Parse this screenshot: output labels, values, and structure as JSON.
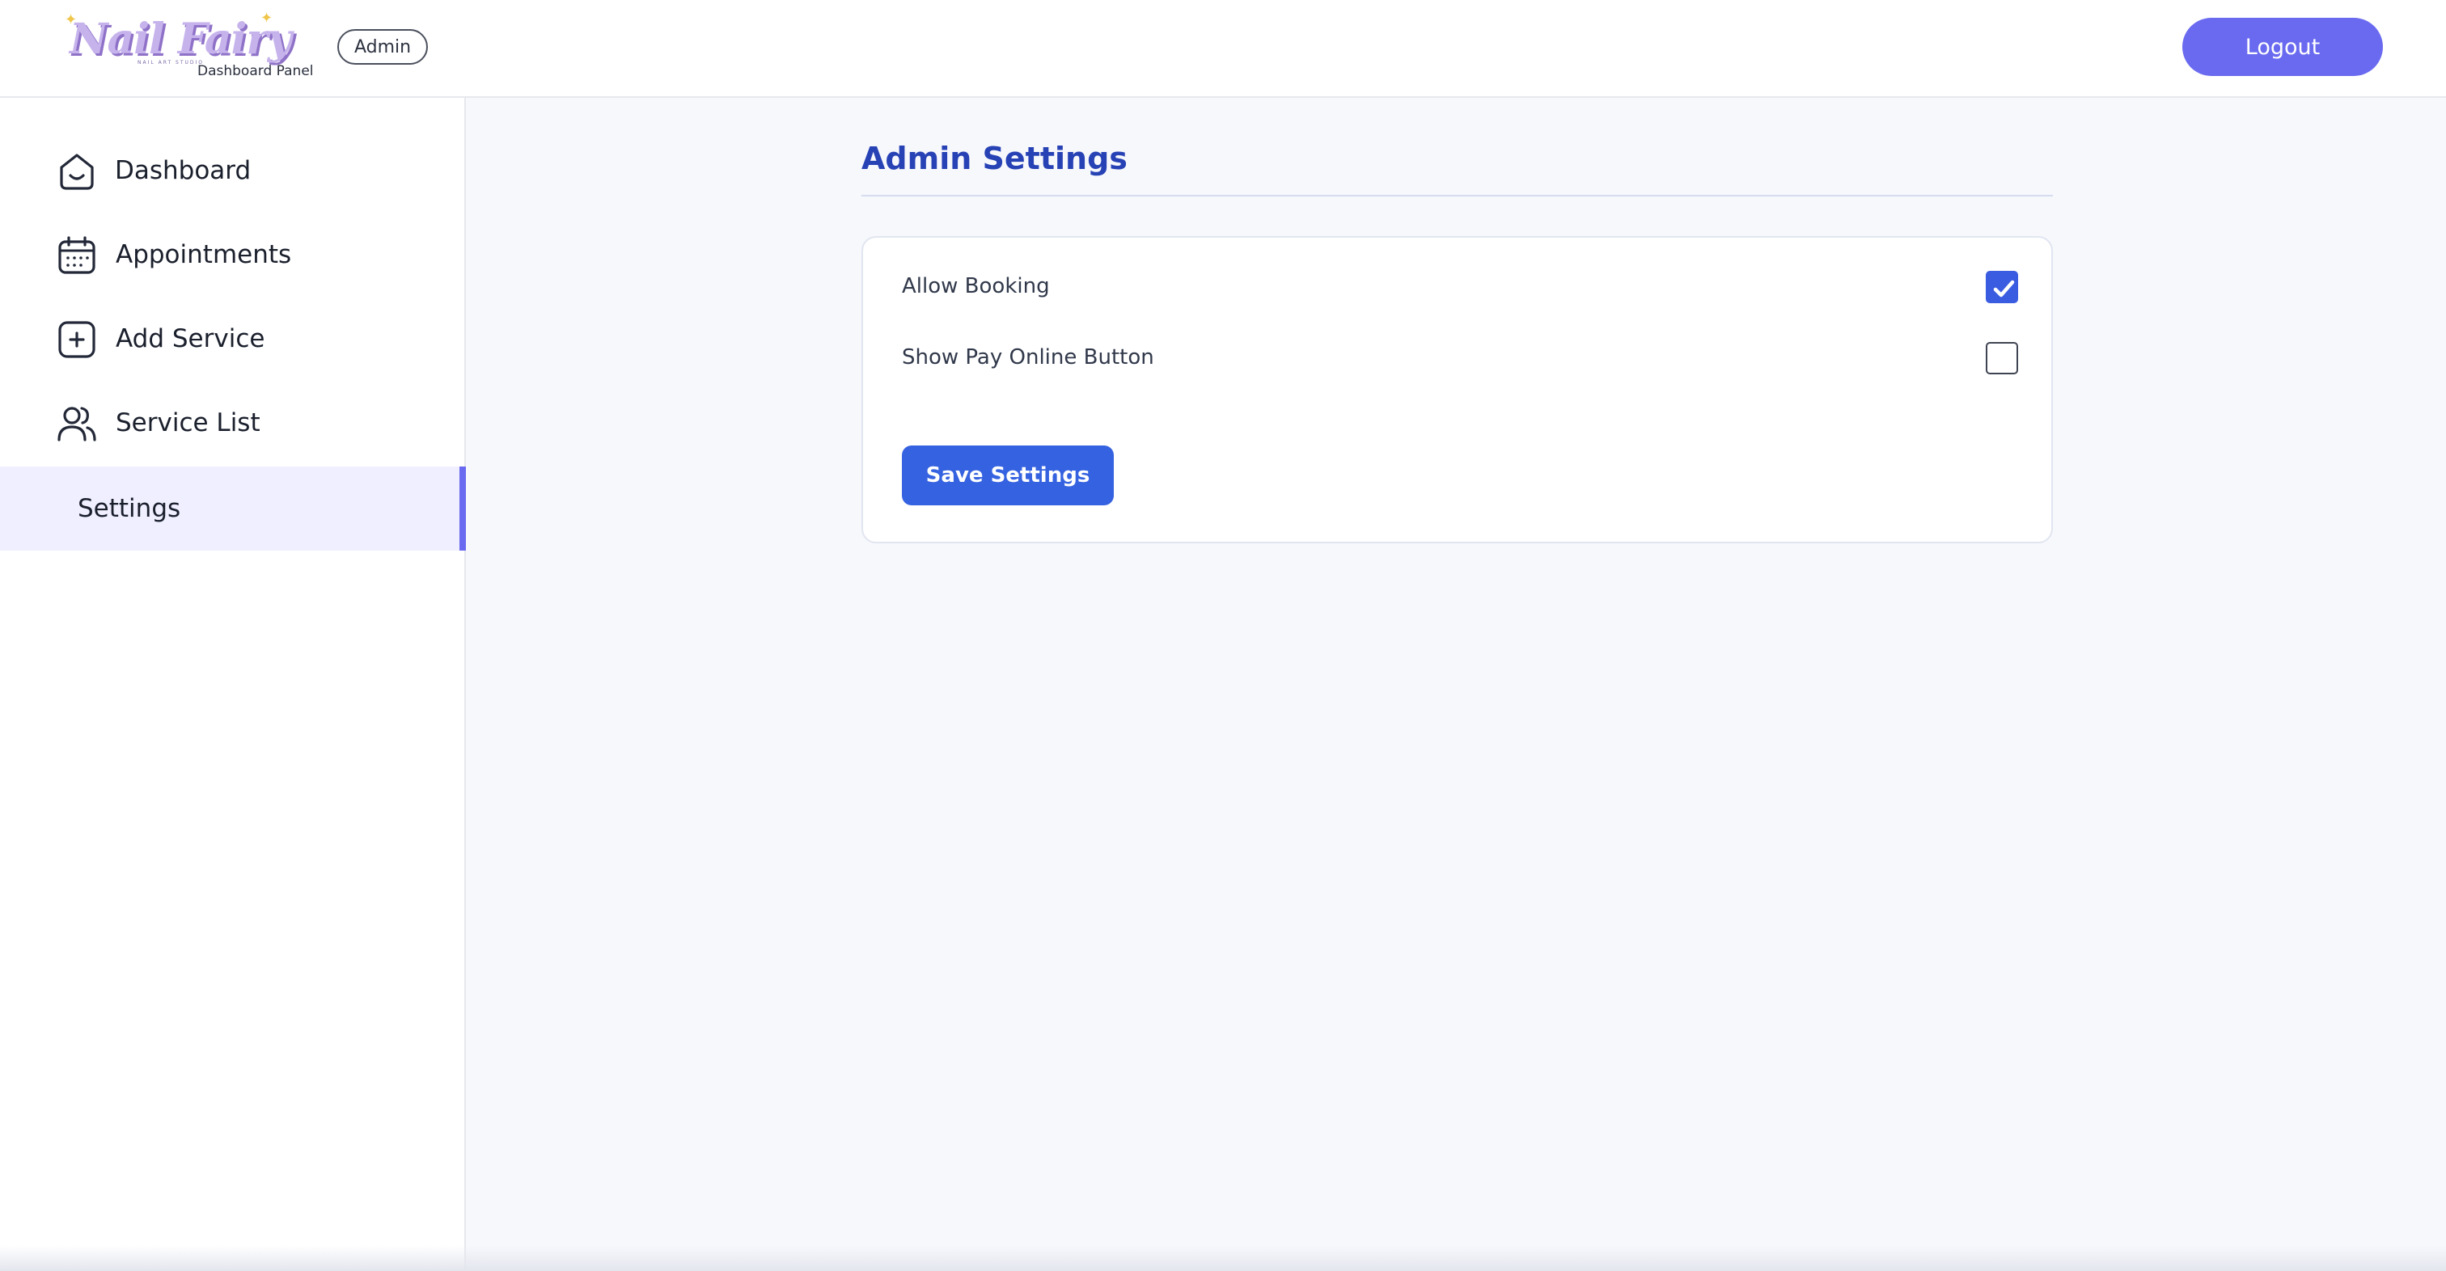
{
  "header": {
    "logo_text": "Nail Fairy",
    "logo_tagline": "NAIL ART STUDIO",
    "logo_subtitle": "Dashboard Panel",
    "role_badge": "Admin",
    "logout_label": "Logout"
  },
  "sidebar": {
    "items": [
      {
        "label": "Dashboard",
        "icon": "home-icon"
      },
      {
        "label": "Appointments",
        "icon": "calendar-icon"
      },
      {
        "label": "Add Service",
        "icon": "plus-square-icon"
      },
      {
        "label": "Service List",
        "icon": "users-icon"
      },
      {
        "label": "Settings",
        "active": true
      }
    ]
  },
  "main": {
    "title": "Admin Settings",
    "settings": [
      {
        "label": "Allow Booking",
        "checked": true
      },
      {
        "label": "Show Pay Online Button",
        "checked": false
      }
    ],
    "save_label": "Save Settings"
  },
  "colors": {
    "accent": "#6a6af0",
    "primary_button": "#3562e0",
    "title": "#2742b5"
  }
}
